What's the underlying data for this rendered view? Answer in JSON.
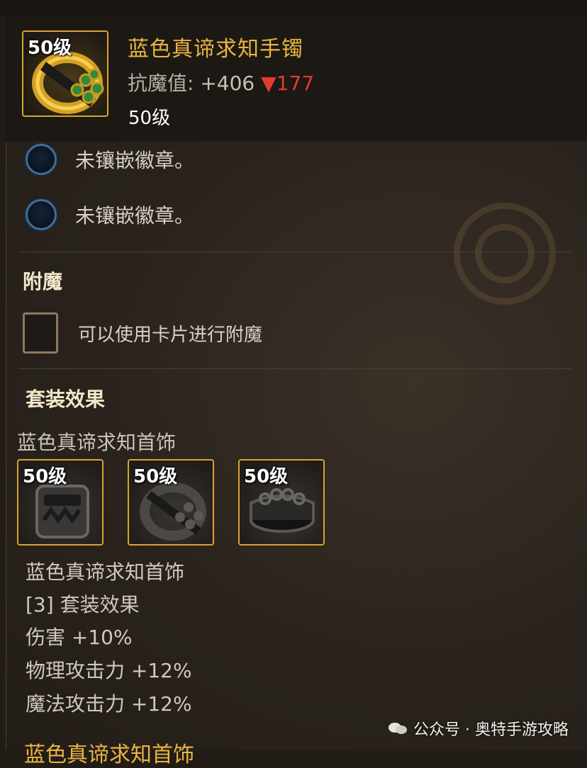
{
  "item": {
    "level_badge": "50级",
    "name": "蓝色真谛求知手镯",
    "stat_label": "抗魔值:",
    "stat_value": "+406",
    "stat_diff": "▼177",
    "level_text": "50级",
    "icon": "gold-bracelet-icon"
  },
  "sockets": [
    {
      "text": "未镶嵌徽章。",
      "icon": "empty-socket-icon"
    },
    {
      "text": "未镶嵌徽章。",
      "icon": "empty-socket-icon"
    }
  ],
  "enchant": {
    "title": "附魔",
    "slot_text": "可以使用卡片进行附魔"
  },
  "set_bonus": {
    "title": "套装效果",
    "set_name": "蓝色真谛求知首饰",
    "items": [
      {
        "level_badge": "50级",
        "icon": "necklace-icon"
      },
      {
        "level_badge": "50级",
        "icon": "bracelet-icon"
      },
      {
        "level_badge": "50级",
        "icon": "ring-icon"
      }
    ],
    "effects": [
      "蓝色真谛求知首饰",
      "[3] 套装效果",
      "伤害 +10%",
      "物理攻击力 +12%",
      "魔法攻击力 +12%"
    ]
  },
  "bottom_cut_text": "蓝色真谛求知首饰",
  "watermark": {
    "text": "公众号 · 奥特手游攻略",
    "icon": "wechat-icon"
  },
  "colors": {
    "title_gold": "#e9b441",
    "downgrade_red": "#e23b30",
    "slot_border": "#d9a42c"
  }
}
